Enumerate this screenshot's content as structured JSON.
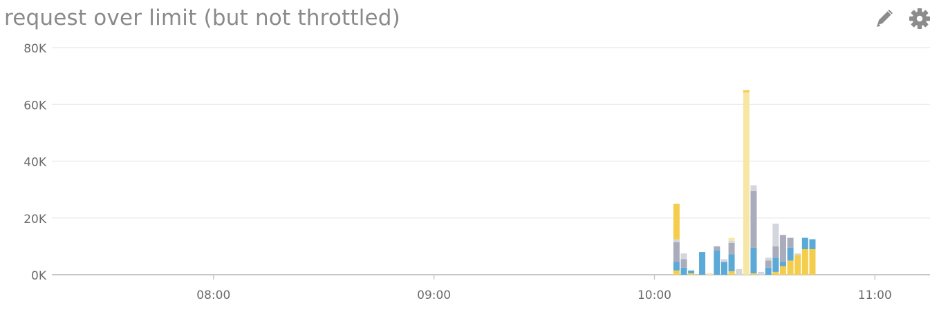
{
  "widget": {
    "title": "request over limit (but not throttled)",
    "icons": {
      "edit": "pencil-icon",
      "settings": "gear-icon"
    },
    "icon_color": "#8c8c8c"
  },
  "chart_data": {
    "type": "bar",
    "stacked": true,
    "title": "request over limit (but not throttled)",
    "xlabel": "",
    "ylabel": "",
    "x_ticks": [
      "08:00",
      "09:00",
      "10:00",
      "11:00"
    ],
    "y_ticks": [
      "0K",
      "20K",
      "40K",
      "60K",
      "80K"
    ],
    "ylim": [
      0,
      80000
    ],
    "xlim": [
      "07:16",
      "11:15"
    ],
    "grid": true,
    "legend": "none",
    "colors": {
      "yellow": "#f5cd4c",
      "light_yellow": "#f8e6a4",
      "blue": "#5aa9d6",
      "gray": "#a9adbb",
      "light_gray": "#d4d6dd"
    },
    "categories": [
      "10:06",
      "10:08",
      "10:10",
      "10:13",
      "10:15",
      "10:17",
      "10:19",
      "10:21",
      "10:23",
      "10:25",
      "10:27",
      "10:29",
      "10:31",
      "10:33",
      "10:35",
      "10:37",
      "10:39",
      "10:41",
      "10:43"
    ],
    "series": [
      {
        "color": "yellow",
        "values": [
          1500,
          0,
          500,
          0,
          0,
          0,
          0,
          1200,
          0,
          0,
          500,
          0,
          0,
          1000,
          3000,
          5000,
          7000,
          9000,
          9000
        ]
      },
      {
        "color": "blue",
        "values": [
          3000,
          2500,
          1000,
          8000,
          0,
          8500,
          4500,
          6000,
          0,
          0,
          9000,
          0,
          2500,
          5000,
          1500,
          4500,
          0,
          4000,
          3500
        ]
      },
      {
        "color": "gray",
        "values": [
          7000,
          3000,
          0,
          0,
          0,
          1500,
          0,
          4000,
          0,
          0,
          20000,
          0,
          2500,
          4000,
          9500,
          3500,
          0,
          0,
          0
        ]
      },
      {
        "color": "light_gray",
        "values": [
          1000,
          2000,
          0,
          0,
          0,
          0,
          1000,
          800,
          2000,
          0,
          2000,
          1000,
          1000,
          8000,
          0,
          0,
          500,
          0,
          0
        ]
      },
      {
        "color": "light_yellow",
        "values": [
          0,
          0,
          0,
          0,
          500,
          0,
          0,
          1000,
          0,
          0,
          0,
          0,
          0,
          0,
          0,
          0,
          0,
          0,
          0
        ]
      },
      {
        "color": "yellow",
        "values": [
          12500,
          0,
          0,
          0,
          0,
          0,
          0,
          0,
          0,
          0,
          0,
          0,
          0,
          0,
          0,
          0,
          0,
          0,
          0
        ]
      }
    ],
    "totals": [
      26000,
      9500,
      1500,
      8000,
      500,
      11000,
      12000,
      14500,
      3000,
      65000,
      33000,
      1000,
      11000,
      22000,
      20000,
      15000,
      14000,
      13000,
      12500
    ],
    "spike": {
      "x": "10:25",
      "value": 65000,
      "colors": [
        "light_yellow",
        "yellow"
      ]
    }
  }
}
